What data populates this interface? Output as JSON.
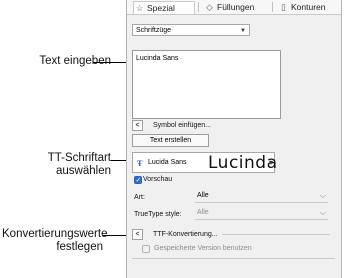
{
  "callouts": {
    "text_eingeben": "Text eingeben",
    "tt_schriftart_line1": "TT-Schriftart",
    "tt_schriftart_line2": "auswählen",
    "konvertierung_line1": "Konvertierungswerte",
    "konvertierung_line2": "festlegen"
  },
  "tabs": [
    {
      "label": "Spezial",
      "icon": "star-icon",
      "active": true
    },
    {
      "label": "Füllungen",
      "icon": "fill-icon",
      "active": false
    },
    {
      "label": "Konturen",
      "icon": "outline-icon",
      "active": false
    }
  ],
  "style_dropdown": {
    "value": "Schriftzüge"
  },
  "text_area": {
    "value": "Lucinda Sans"
  },
  "symbol_insert": {
    "arrow": "<",
    "label": "Symbol einfügen..."
  },
  "create_text_button": {
    "label": "Text erstellen"
  },
  "font_selector": {
    "tt_glyph": "Ŧ",
    "name": "Lucida Sans",
    "preview": "Lucinda"
  },
  "preview_checkbox": {
    "label": "Vorschau",
    "checked": true
  },
  "art_field": {
    "label": "Art:",
    "value": "Alle"
  },
  "truetype_field": {
    "label": "TrueType style:",
    "value": "Alle"
  },
  "ttf_conversion": {
    "arrow": "<",
    "label": "TTF-Konvertierung..."
  },
  "saved_version_checkbox": {
    "label": "Gespeicherte Version benutzen",
    "checked": false
  },
  "colors": {
    "accent": "#2f6fd6",
    "panel_bg": "#f0f0f0"
  }
}
